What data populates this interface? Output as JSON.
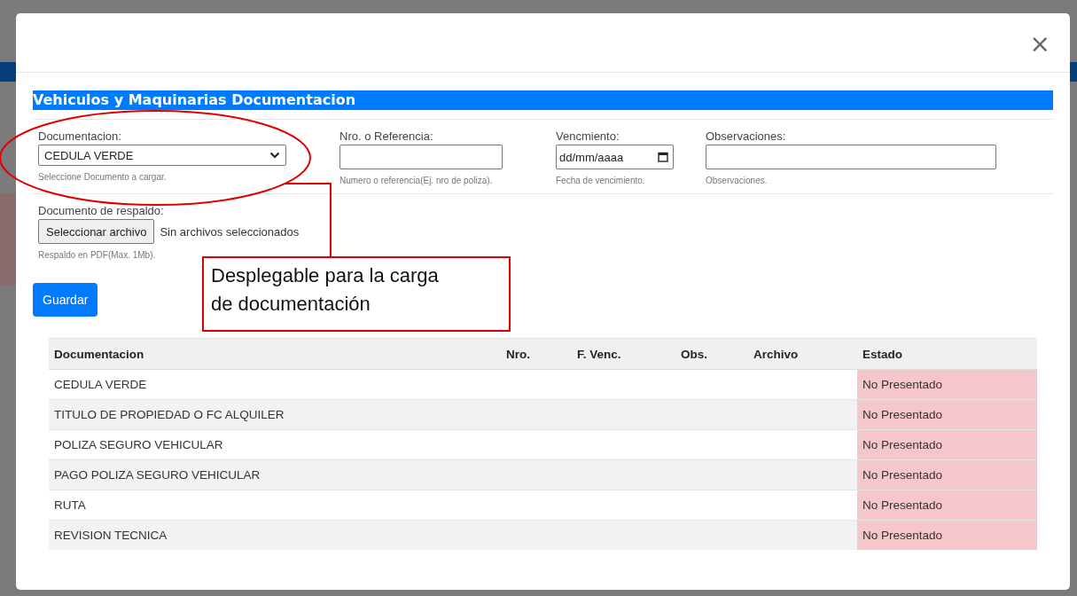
{
  "modal": {
    "close": "×",
    "section_title": "Vehiculos y Maquinarias Documentacion",
    "fields": [
      {
        "kind": "select",
        "label": "Documentacion:",
        "value": "CEDULA VERDE",
        "help": "Seleccione Documento a cargar."
      },
      {
        "kind": "text",
        "label": "Nro. o Referencia:",
        "help": "Numero o referencia(Ej. nro de poliza)."
      },
      {
        "kind": "date",
        "label": "Vencmiento:",
        "placeholder": "dd/mm/aaaa",
        "help": "Fecha de vencimiento."
      },
      {
        "kind": "text",
        "label": "Observaciones:",
        "help": "Observaciones."
      }
    ],
    "file": {
      "label": "Documento de respaldo:",
      "button": "Seleccionar archivo",
      "status": "Sin archivos seleccionados",
      "help": "Respaldo en PDF(Max. 1Mb)."
    },
    "save_button": "Guardar",
    "table": {
      "columns": [
        "Documentacion",
        "Nro.",
        "F. Venc.",
        "Obs.",
        "Archivo",
        "Estado"
      ],
      "rows": [
        {
          "document": "CEDULA VERDE",
          "status": "No Presentado",
          "presented": false
        },
        {
          "document": "TITULO DE PROPIEDAD O FC ALQUILER",
          "status": "No Presentado",
          "presented": false
        },
        {
          "document": "POLIZA SEGURO VEHICULAR",
          "status": "No Presentado",
          "presented": false
        },
        {
          "document": "PAGO POLIZA SEGURO VEHICULAR",
          "status": "No Presentado",
          "presented": false
        },
        {
          "document": "RUTA",
          "status": "No Presentado",
          "presented": false
        },
        {
          "document": "REVISION TECNICA",
          "status": "No Presentado",
          "presented": false
        }
      ]
    }
  },
  "annotation": {
    "callout": "Desplegable para la carga de documentación"
  }
}
